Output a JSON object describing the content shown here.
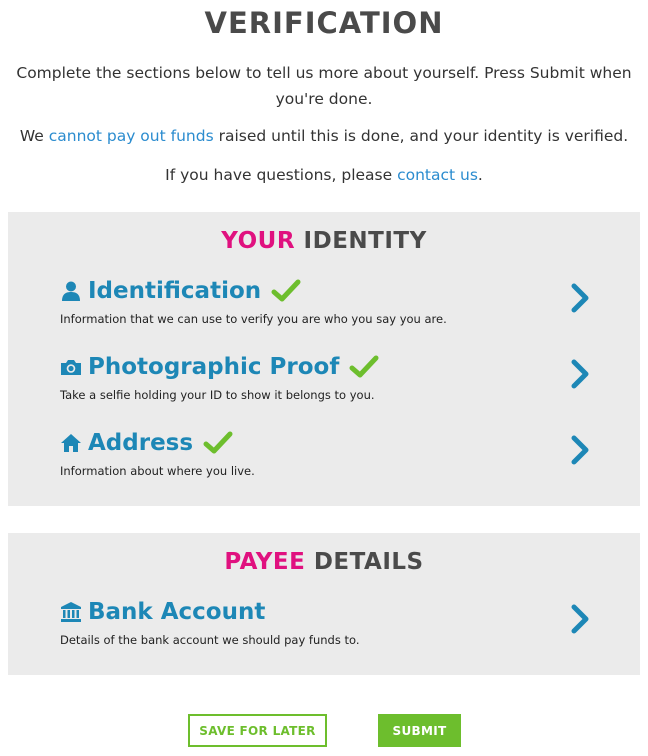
{
  "page": {
    "title": "VERIFICATION",
    "intro_line1": "Complete the sections below to tell us more about yourself. Press Submit when you're done.",
    "intro_line2": {
      "before": "We ",
      "link": "cannot pay out funds",
      "after": " raised until this is done, and your identity is verified."
    },
    "intro_line3": {
      "before": "If you have questions, please ",
      "link": "contact us",
      "after": "."
    }
  },
  "identity": {
    "title_accent": "YOUR",
    "title_rest": " IDENTITY",
    "items": [
      {
        "icon": "user-icon",
        "title": "Identification",
        "description": "Information that we can use to verify you are who you say you are.",
        "verified": true
      },
      {
        "icon": "camera-icon",
        "title": "Photographic Proof",
        "description": "Take a selfie holding your ID to show it belongs to you.",
        "verified": true
      },
      {
        "icon": "home-icon",
        "title": "Address",
        "description": "Information about where you live.",
        "verified": true
      }
    ]
  },
  "payee": {
    "title_accent": "PAYEE",
    "title_rest": " DETAILS",
    "items": [
      {
        "icon": "bank-icon",
        "title": "Bank Account",
        "description": "Details of the bank account we should pay funds to.",
        "verified": false
      }
    ]
  },
  "buttons": {
    "save_later": "SAVE FOR LATER",
    "submit": "SUBMIT"
  },
  "colors": {
    "accent_pink": "#e0117f",
    "title_blue": "#1d87b6",
    "link_blue": "#2b8ccf",
    "check_green": "#6dbe2d",
    "panel_bg": "#ebebeb"
  }
}
